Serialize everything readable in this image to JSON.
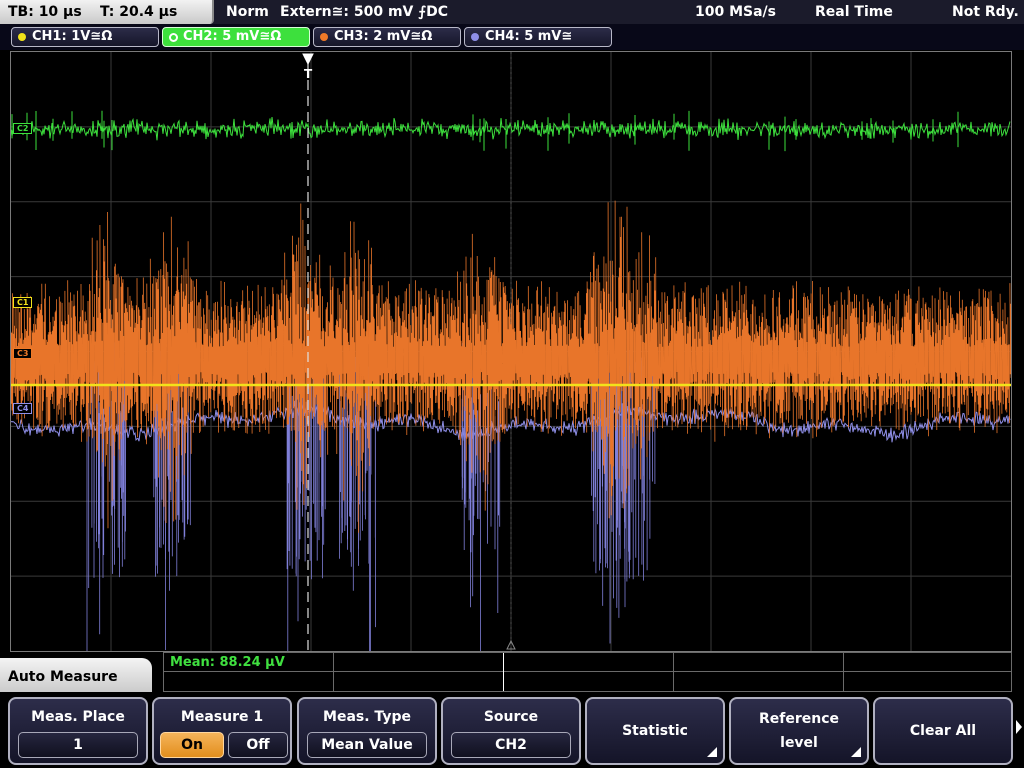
{
  "status": {
    "timebase": "TB: 10 µs",
    "trigger_pos": "T: 20.4 µs",
    "mode": "Norm",
    "trigger_source": "Extern≅: 500 mV ⨍DC",
    "sample_rate": "100 MSa/s",
    "acq_mode": "Real Time",
    "ready_state": "Not Rdy."
  },
  "channels": [
    {
      "label": "CH1: 1V≅Ω",
      "color": "#f2e21a"
    },
    {
      "label": "CH2: 5 mV≅Ω",
      "color": "#3de03d"
    },
    {
      "label": "CH3: 2 mV≅Ω",
      "color": "#f07a28"
    },
    {
      "label": "CH4: 5 mV≅",
      "color": "#8f8fe8"
    }
  ],
  "markers": {
    "ch2": "C2",
    "ch1": "C1",
    "ch3": "C3",
    "ch4": "C4"
  },
  "trigger_marker": "T",
  "measurement": {
    "mean_text": "Mean: 88.24 µV"
  },
  "menu": {
    "title": "Auto Measure",
    "meas_place": {
      "label": "Meas. Place",
      "value": "1"
    },
    "measure1": {
      "label": "Measure 1",
      "on": "On",
      "off": "Off",
      "state": "on"
    },
    "meas_type": {
      "label": "Meas. Type",
      "value": "Mean Value"
    },
    "source": {
      "label": "Source",
      "value": "CH2"
    },
    "statistic": {
      "label": "Statistic"
    },
    "reference": {
      "label_line1": "Reference",
      "label_line2": "level"
    },
    "clear_all": {
      "label": "Clear All"
    }
  },
  "icons": [
    "trigger-marker-icon",
    "submenu-arrow-icon",
    "channel-dot-icon",
    "ground-marker-icon"
  ]
}
